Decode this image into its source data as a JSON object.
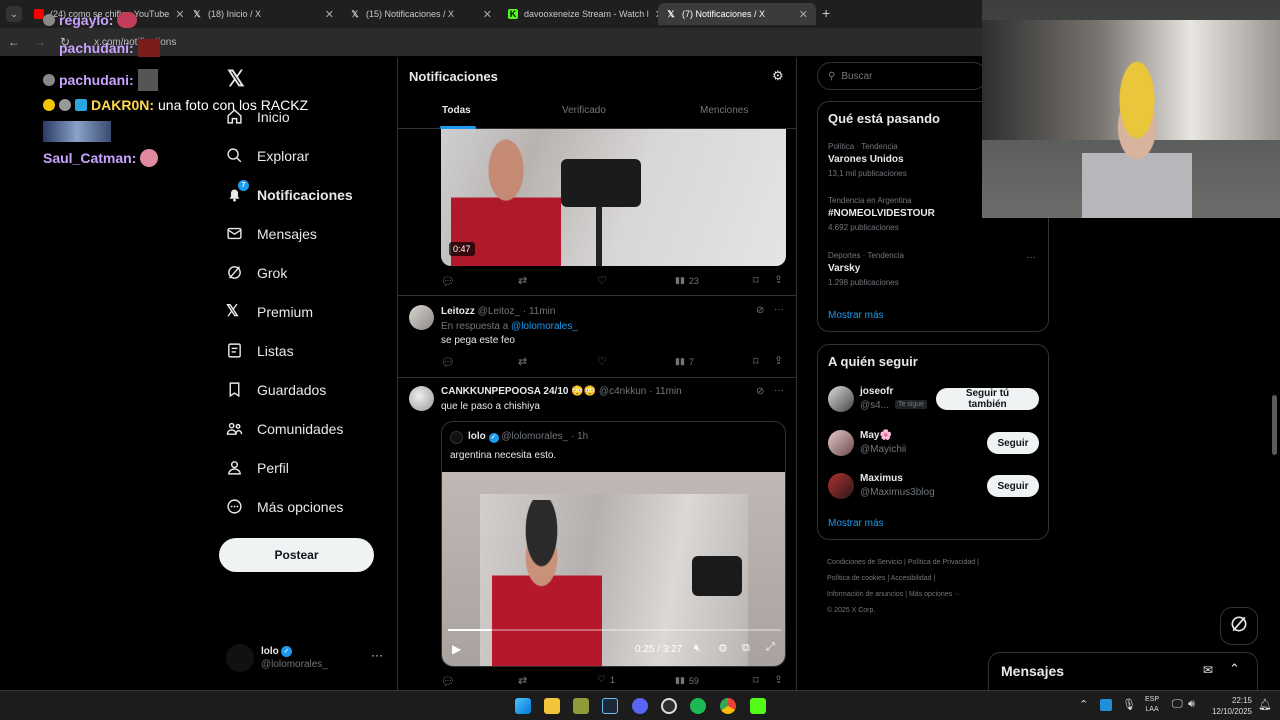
{
  "browser": {
    "tabs": [
      {
        "title": "(24) como se chifla - YouTube",
        "color": "#ff0000"
      },
      {
        "title": "(18) Inicio / X",
        "color": "#ffffff"
      },
      {
        "title": "(15) Notificaciones / X",
        "color": "#ffffff"
      },
      {
        "title": "davooxeneize Stream - Watch l",
        "color": "#53fc18"
      },
      {
        "title": "(7) Notificaciones / X",
        "color": "#ffffff"
      }
    ],
    "url": "x.com/notifications"
  },
  "stream_chat": [
    {
      "user": "regaylo:",
      "color": "#c9a3ff",
      "text": ""
    },
    {
      "user": "pachudani:",
      "color": "#c9a3ff",
      "text": ""
    },
    {
      "user": "pachudani:",
      "color": "#c9a3ff",
      "text": ""
    },
    {
      "user": "DAKR0N:",
      "color": "#ffd84a",
      "text": "una foto con los RACKZ"
    },
    {
      "user": "Saul_Catman:",
      "color": "#c9a3ff",
      "text": ""
    }
  ],
  "nav": {
    "items": [
      {
        "label": "Inicio",
        "icon": "home-icon"
      },
      {
        "label": "Explorar",
        "icon": "search-icon"
      },
      {
        "label": "Notificaciones",
        "icon": "bell-icon",
        "badge": "7"
      },
      {
        "label": "Mensajes",
        "icon": "mail-icon"
      },
      {
        "label": "Grok",
        "icon": "grok-icon"
      },
      {
        "label": "Premium",
        "icon": "x-logo-icon"
      },
      {
        "label": "Listas",
        "icon": "list-icon"
      },
      {
        "label": "Guardados",
        "icon": "bookmark-icon"
      },
      {
        "label": "Comunidades",
        "icon": "communities-icon"
      },
      {
        "label": "Perfil",
        "icon": "person-icon"
      },
      {
        "label": "Más opciones",
        "icon": "more-circle-icon"
      }
    ],
    "post_label": "Postear",
    "account": {
      "name": "lolo",
      "handle": "@lolomorales_"
    }
  },
  "notifications": {
    "title": "Notificaciones",
    "tabs": [
      "Todas",
      "Verificado",
      "Menciones"
    ],
    "active_tab": "Todas",
    "top_video": {
      "duration": "0:47",
      "views": "23"
    },
    "posts": [
      {
        "name": "Leitozz",
        "handle": "@Leitoz_",
        "time": "· 11min",
        "reply_prefix": "En respuesta a",
        "reply_to": "@lolomorales_",
        "text": "se pega este feo",
        "views": "7"
      },
      {
        "name": "CANKKUNPEPOOSA 24/10",
        "handle": "@c4nkkun",
        "time": "· 11min",
        "text": "que le paso a chishiya",
        "likes": "1",
        "views": "59",
        "quote": {
          "name": "lolo",
          "handle": "@lolomorales_",
          "time": "· 1h",
          "text": "argentina necesita esto.",
          "video_time": "0:25 / 3:27",
          "progress": 0.13
        }
      }
    ]
  },
  "search": {
    "placeholder": "Buscar"
  },
  "trends": {
    "title": "Qué está pasando",
    "items": [
      {
        "context": "Política · Tendencia",
        "name": "Varones Unidos",
        "count": "13,1 mil publicaciones"
      },
      {
        "context": "Tendencia en Argentina",
        "name": "#NOMEOLVIDESTOUR",
        "count": "4.692 publicaciones"
      },
      {
        "context": "Deportes · Tendencia",
        "name": "Varsky",
        "count": "1.298 publicaciones"
      }
    ],
    "more": "Mostrar más"
  },
  "who_to_follow": {
    "title": "A quién seguir",
    "items": [
      {
        "name": "joseofr",
        "handle": "@s4...",
        "badge": "Te sigue",
        "button": "Seguir tú también"
      },
      {
        "name": "May🌸",
        "handle": "@Mayichii",
        "button": "Seguir"
      },
      {
        "name": "Maximus",
        "handle": "@Maximus3blog",
        "button": "Seguir"
      }
    ],
    "more": "Mostrar más"
  },
  "footer": {
    "links": [
      "Condiciones de Servicio",
      "Política de Privacidad",
      "Política de cookies",
      "Accesibilidad",
      "Información de anuncios",
      "Más opciones ···"
    ],
    "copyright": "© 2025 X Corp."
  },
  "messages_drawer": {
    "title": "Mensajes"
  },
  "taskbar": {
    "lang": "ESP",
    "lang2": "LAA",
    "time": "22:15",
    "date": "12/10/2025"
  }
}
